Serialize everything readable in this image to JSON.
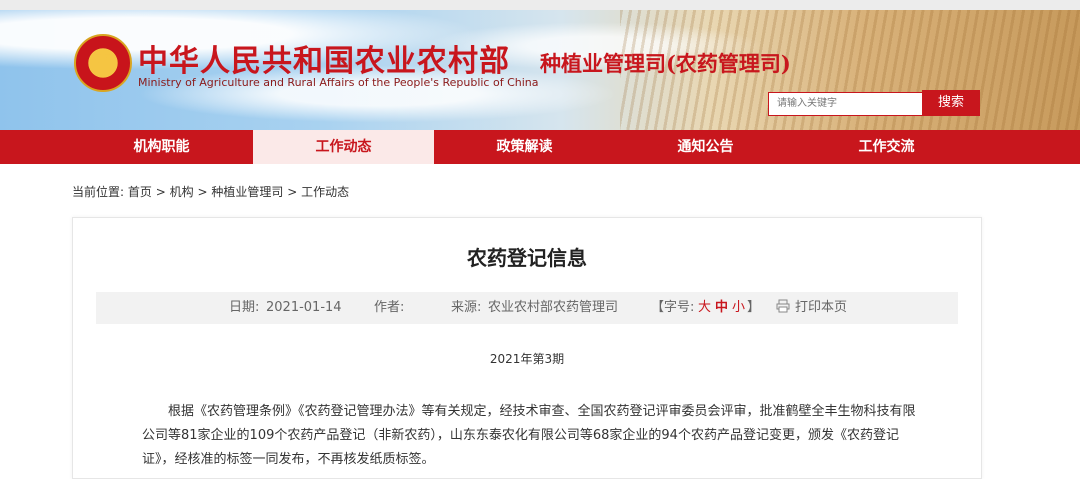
{
  "header": {
    "title_cn": "中华人民共和国农业农村部",
    "title_en": "Ministry of Agriculture and Rural Affairs of the People's Republic of China",
    "department": "种植业管理司(农药管理司)",
    "search": {
      "placeholder": "请输入关键字",
      "button": "搜索"
    },
    "emblem_icon": "national-emblem"
  },
  "nav": {
    "items": [
      "机构职能",
      "工作动态",
      "政策解读",
      "通知公告",
      "工作交流"
    ],
    "active_index": 1
  },
  "breadcrumb": {
    "prefix": "当前位置:",
    "path": [
      "首页",
      "机构",
      "种植业管理司",
      "工作动态"
    ],
    "separator": ">"
  },
  "article": {
    "title": "农药登记信息",
    "meta": {
      "date_label": "日期:",
      "date": "2021-01-14",
      "author_label": "作者:",
      "source_label": "来源:",
      "source": "农业农村部农药管理司",
      "fontsize_label": "【字号:",
      "size_large": "大",
      "size_medium": "中",
      "size_small": "小",
      "fontsize_close": "】",
      "print": "打印本页",
      "print_icon": "printer-icon"
    },
    "issue": "2021年第3期",
    "body": "根据《农药管理条例》《农药登记管理办法》等有关规定，经技术审查、全国农药登记评审委员会评审，批准鹤壁全丰生物科技有限公司等81家企业的109个农药产品登记（非新农药），山东东泰农化有限公司等68家企业的94个农药产品登记变更，颁发《农药登记证》，经核准的标签一同发布，不再核发纸质标签。"
  },
  "colors": {
    "brand_red": "#c8161d",
    "nav_active_bg": "#fbe9e8",
    "meta_bg": "#f2f2f2"
  }
}
